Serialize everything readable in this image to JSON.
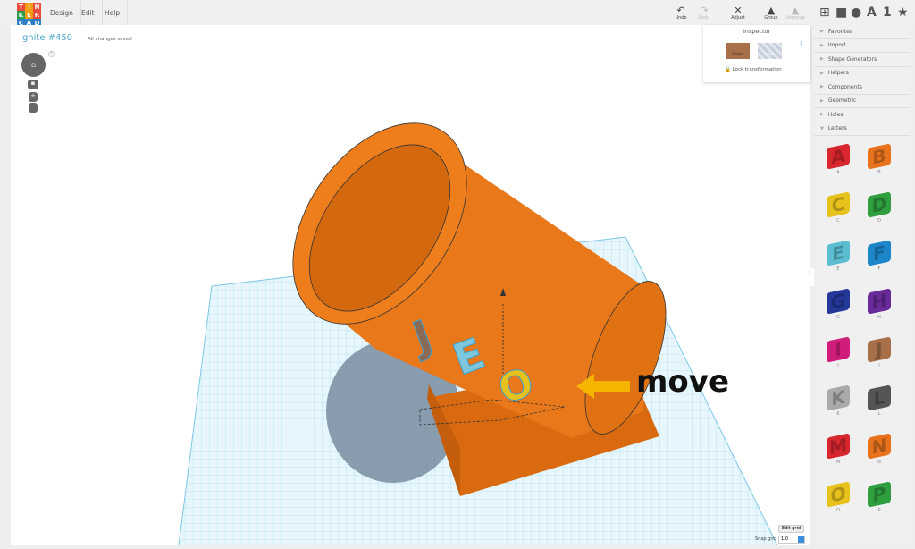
{
  "logo": [
    "T",
    "I",
    "N",
    "K",
    "E",
    "R",
    "C",
    "A",
    "D"
  ],
  "logo_colors": [
    "#e94b3c",
    "#f39c12",
    "#e94b3c",
    "#2e9e4b",
    "#f39c12",
    "#e94b3c",
    "#2e7ec4",
    "#2e7ec4",
    "#2e7ec4"
  ],
  "menu": [
    "Design",
    "Edit",
    "Help"
  ],
  "toolbar": {
    "undo": "Undo",
    "redo": "Redo",
    "adjust": "Adjust",
    "group": "Group",
    "ungroup": "Ungroup",
    "view_a": "A",
    "view_1": "1"
  },
  "project": {
    "title": "Ignite #450",
    "status": "All changes saved"
  },
  "nav": {
    "help": "?",
    "zoom_in": "+",
    "zoom_out": "-"
  },
  "inspector": {
    "title": "Inspector",
    "color": "Color",
    "hole": "Hole",
    "lock": "Lock transformation",
    "help": "?"
  },
  "categories": [
    {
      "label": "Favorites",
      "open": false
    },
    {
      "label": "Import",
      "open": false
    },
    {
      "label": "Shape Generators",
      "open": false
    },
    {
      "label": "Helpers",
      "open": false
    },
    {
      "label": "Components",
      "open": false
    },
    {
      "label": "Geometric",
      "open": false
    },
    {
      "label": "Holes",
      "open": false
    },
    {
      "label": "Letters",
      "open": true
    }
  ],
  "letters": [
    {
      "l": "A",
      "c": "#d8262e"
    },
    {
      "l": "B",
      "c": "#e8731c"
    },
    {
      "l": "C",
      "c": "#e8c21c"
    },
    {
      "l": "D",
      "c": "#2e9e3e"
    },
    {
      "l": "E",
      "c": "#5bbdd0"
    },
    {
      "l": "F",
      "c": "#1c86c8"
    },
    {
      "l": "G",
      "c": "#24389a"
    },
    {
      "l": "H",
      "c": "#6a2a9a"
    },
    {
      "l": "I",
      "c": "#d01c7a"
    },
    {
      "l": "J",
      "c": "#a87048"
    },
    {
      "l": "K",
      "c": "#aaaaaa"
    },
    {
      "l": "L",
      "c": "#555555"
    },
    {
      "l": "M",
      "c": "#d8262e"
    },
    {
      "l": "N",
      "c": "#e8731c"
    },
    {
      "l": "O",
      "c": "#e8c21c"
    },
    {
      "l": "P",
      "c": "#2e9e3e"
    }
  ],
  "grid": {
    "edit": "Edit grid",
    "snap_label": "Snap grid",
    "snap_value": "1.0"
  },
  "annotation": "move",
  "scene_letters": [
    "J",
    "E",
    "O"
  ]
}
